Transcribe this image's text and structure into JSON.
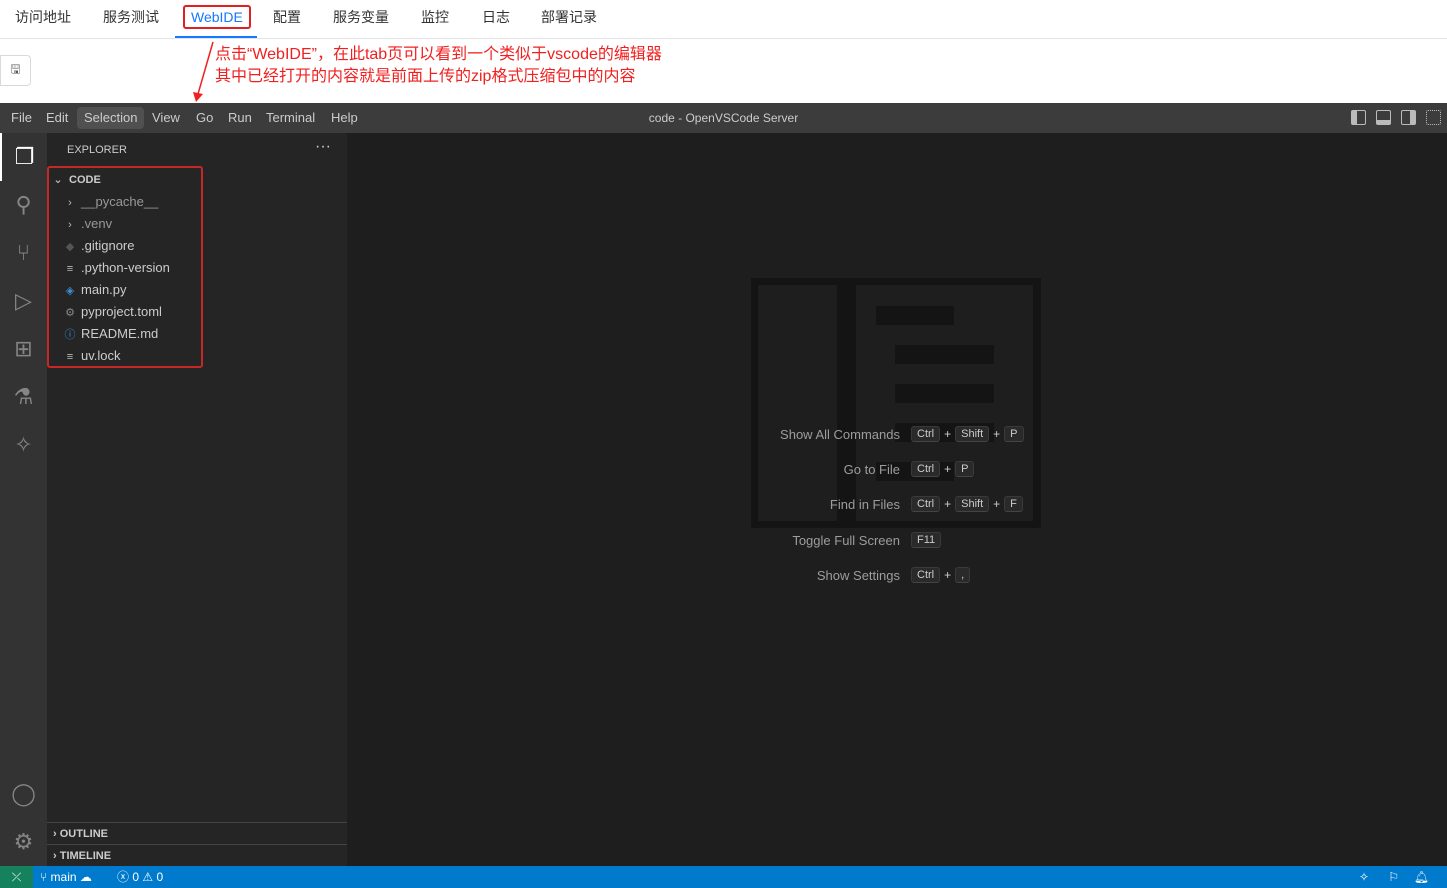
{
  "tabs": [
    "访问地址",
    "服务测试",
    "WebIDE",
    "配置",
    "服务变量",
    "监控",
    "日志",
    "部署记录"
  ],
  "annotation": {
    "line1": "点击“WebIDE”，在此tab页可以看到一个类似于vscode的编辑器",
    "line2": "其中已经打开的内容就是前面上传的zip格式压缩包中的内容"
  },
  "menu": [
    "File",
    "Edit",
    "Selection",
    "View",
    "Go",
    "Run",
    "Terminal",
    "Help"
  ],
  "window_title": "code - OpenVSCode Server",
  "explorer": {
    "title": "EXPLORER",
    "root": "CODE",
    "items": [
      "__pycache__",
      ".venv",
      ".gitignore",
      ".python-version",
      "main.py",
      "pyproject.toml",
      "README.md",
      "uv.lock"
    ],
    "outline": "OUTLINE",
    "timeline": "TIMELINE"
  },
  "shortcuts": [
    {
      "label": "Show All Commands",
      "keys": [
        "Ctrl",
        "Shift",
        "P"
      ]
    },
    {
      "label": "Go to File",
      "keys": [
        "Ctrl",
        "P"
      ]
    },
    {
      "label": "Find in Files",
      "keys": [
        "Ctrl",
        "Shift",
        "F"
      ]
    },
    {
      "label": "Toggle Full Screen",
      "keys": [
        "F11"
      ]
    },
    {
      "label": "Show Settings",
      "keys": [
        "Ctrl",
        ","
      ]
    }
  ],
  "status": {
    "branch": "main",
    "errors": "0",
    "warnings": "0"
  }
}
